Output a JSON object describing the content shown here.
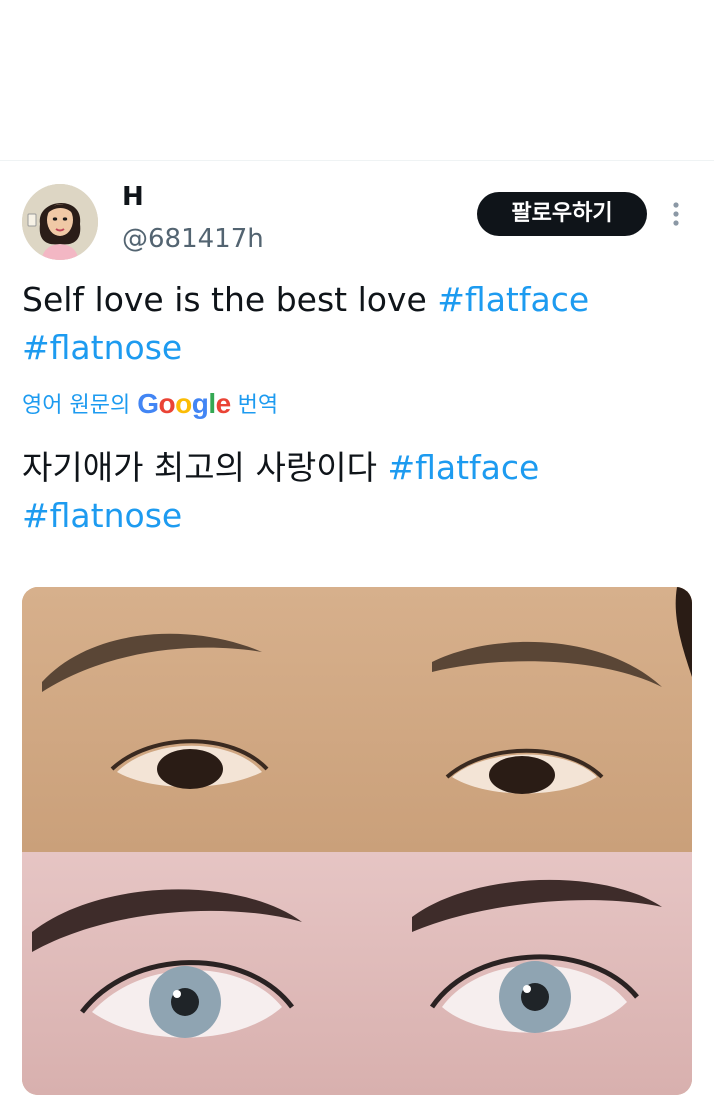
{
  "tweet": {
    "author_name": "H",
    "author_handle": "@681417h",
    "follow_label": "팔로우하기",
    "text": "Self love is the best love",
    "hashtags": [
      "#flatface",
      "#flatnose"
    ],
    "translate": {
      "prefix": "영어 원문의",
      "google": [
        "G",
        "o",
        "o",
        "g",
        "l",
        "e"
      ],
      "suffix": "번역"
    },
    "translated_text": "자기애가 최고의 사랑이다",
    "media_alt": ""
  },
  "colors": {
    "link": "#1d9bf0",
    "text": "#0f1419",
    "muted": "#536471",
    "button_bg": "#0f1419",
    "google": [
      "#4285f4",
      "#ea4335",
      "#fbbc05",
      "#4285f4",
      "#34a853",
      "#ea4335"
    ]
  },
  "icons": {
    "more": "more-vertical-icon"
  }
}
